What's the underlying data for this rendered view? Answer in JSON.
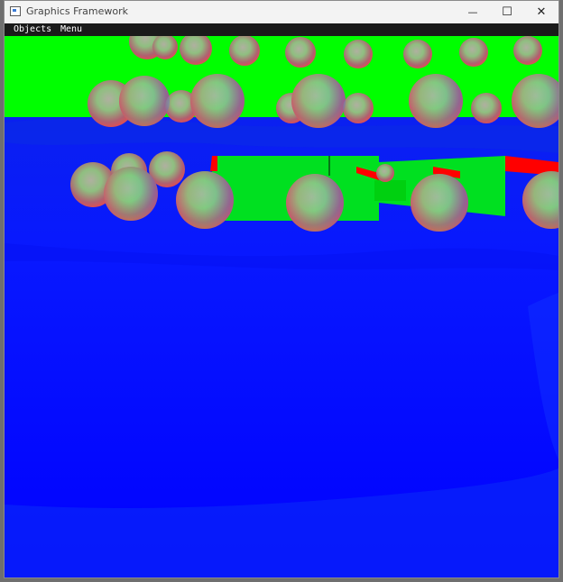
{
  "window": {
    "title": "Graphics Framework",
    "icon": "app-window-icon"
  },
  "controls": {
    "minimize_glyph": "—",
    "maximize_glyph": "☐",
    "close_glyph": "✕"
  },
  "menubar": {
    "items": [
      {
        "label": "Objects"
      },
      {
        "label": "Menu"
      }
    ]
  },
  "scene": {
    "sky_color": "#00ff00",
    "ground_color": "#0000ff",
    "accent_red": "#ff0000"
  }
}
